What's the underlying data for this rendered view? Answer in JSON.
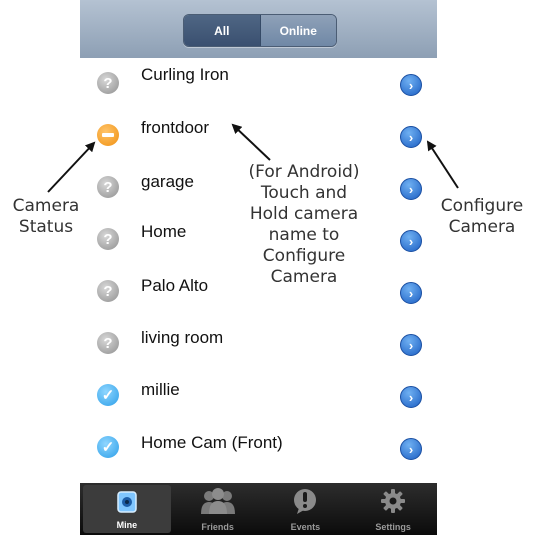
{
  "segment": {
    "all": "All",
    "online": "Online"
  },
  "cameras": [
    {
      "name": "Curling Iron",
      "status": "unknown"
    },
    {
      "name": "frontdoor",
      "status": "blocked"
    },
    {
      "name": "garage",
      "status": "unknown"
    },
    {
      "name": "Home",
      "status": "unknown"
    },
    {
      "name": "Palo Alto",
      "status": "unknown"
    },
    {
      "name": "living room",
      "status": "unknown"
    },
    {
      "name": "millie",
      "status": "online"
    },
    {
      "name": "Home Cam (Front)",
      "status": "online"
    }
  ],
  "tabs": [
    {
      "label": "Mine",
      "icon": "camera-icon",
      "active": true
    },
    {
      "label": "Friends",
      "icon": "friends-icon",
      "active": false
    },
    {
      "label": "Events",
      "icon": "alert-icon",
      "active": false
    },
    {
      "label": "Settings",
      "icon": "gear-icon",
      "active": false
    }
  ],
  "annotations": {
    "camera_status": "Camera\nStatus",
    "android_hint": "(For Android)\nTouch and\nHold camera\nname to\nConfigure\nCamera",
    "configure_camera": "Configure\nCamera"
  },
  "colors": {
    "disclosure_blue": "#1c5fc3",
    "status_unknown": "#8f8f8f",
    "status_blocked": "#f09010",
    "status_online": "#2b9ee8"
  }
}
